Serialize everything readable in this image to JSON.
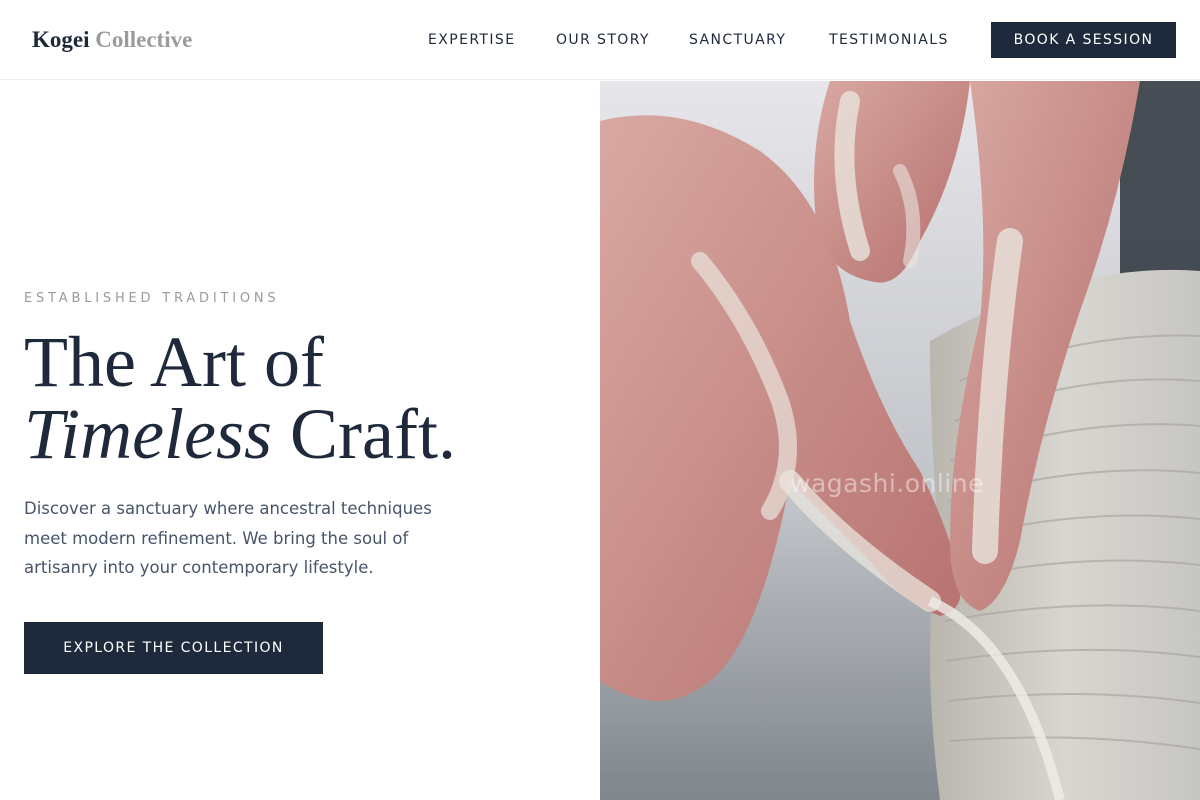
{
  "brand": {
    "name_primary": "Kogei",
    "name_secondary": "Collective"
  },
  "nav": {
    "items": [
      {
        "label": "EXPERTISE"
      },
      {
        "label": "OUR STORY"
      },
      {
        "label": "SANCTUARY"
      },
      {
        "label": "TESTIMONIALS"
      }
    ],
    "cta_label": "BOOK A SESSION"
  },
  "hero": {
    "eyebrow": "ESTABLISHED TRADITIONS",
    "headline_line1": "The Art of",
    "headline_italic": "Timeless",
    "headline_rest": " Craft.",
    "body": "Discover a sanctuary where ancestral techniques meet modern refinement. We bring the soul of artisanry into your contemporary lifestyle.",
    "cta_label": "EXPLORE THE COLLECTION",
    "image": {
      "subject": "hands shaping clay on a pottery wheel",
      "watermark": "wagashi.online"
    }
  },
  "colors": {
    "brand_dark": "#1e293b",
    "muted_gray": "#9b9b9b",
    "body_text": "#475569",
    "background": "#ffffff"
  }
}
